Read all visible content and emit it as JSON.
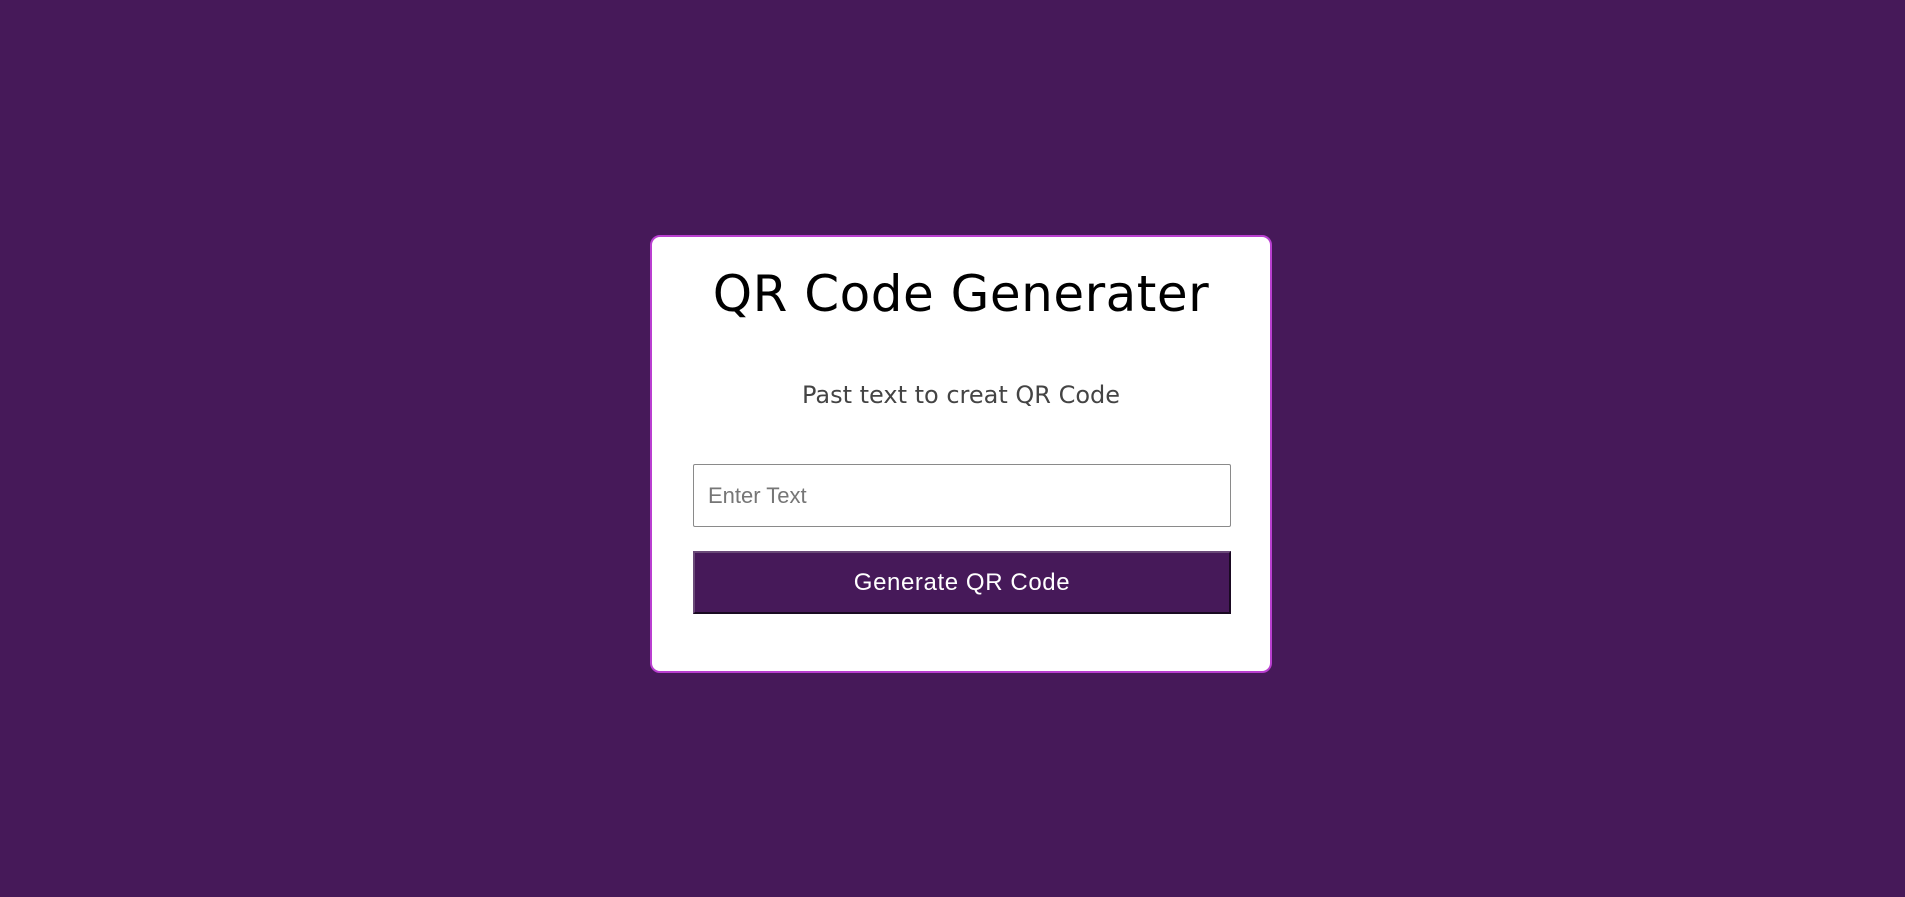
{
  "colors": {
    "background": "#461959",
    "card_border": "#b93fd0",
    "button_background": "#461959",
    "button_text": "#ffffff"
  },
  "card": {
    "title": "QR Code Generater",
    "subtitle": "Past text to creat QR Code",
    "input": {
      "value": "",
      "placeholder": "Enter Text"
    },
    "generate_button_label": "Generate QR Code"
  }
}
